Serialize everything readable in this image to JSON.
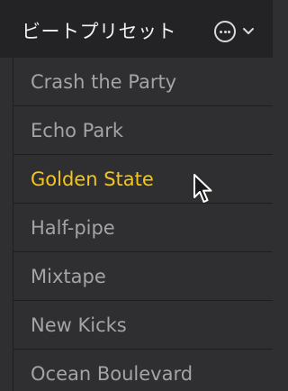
{
  "header": {
    "title": "ビートプリセット",
    "more_icon": "ellipsis-circle-icon",
    "menu_icon": "chevron-down-icon"
  },
  "presets": [
    {
      "label": "Crash the Party",
      "selected": false
    },
    {
      "label": "Echo Park",
      "selected": false
    },
    {
      "label": "Golden State",
      "selected": true
    },
    {
      "label": "Half-pipe",
      "selected": false
    },
    {
      "label": "Mixtape",
      "selected": false
    },
    {
      "label": "New Kicks",
      "selected": false
    },
    {
      "label": "Ocean Boulevard",
      "selected": false
    }
  ],
  "colors": {
    "background": "#2f2f31",
    "header_background": "#232325",
    "item_text": "#a4a4a6",
    "selected_text": "#f5c518",
    "divider": "#1e1e20"
  },
  "pointer": "arrow-cursor-icon"
}
